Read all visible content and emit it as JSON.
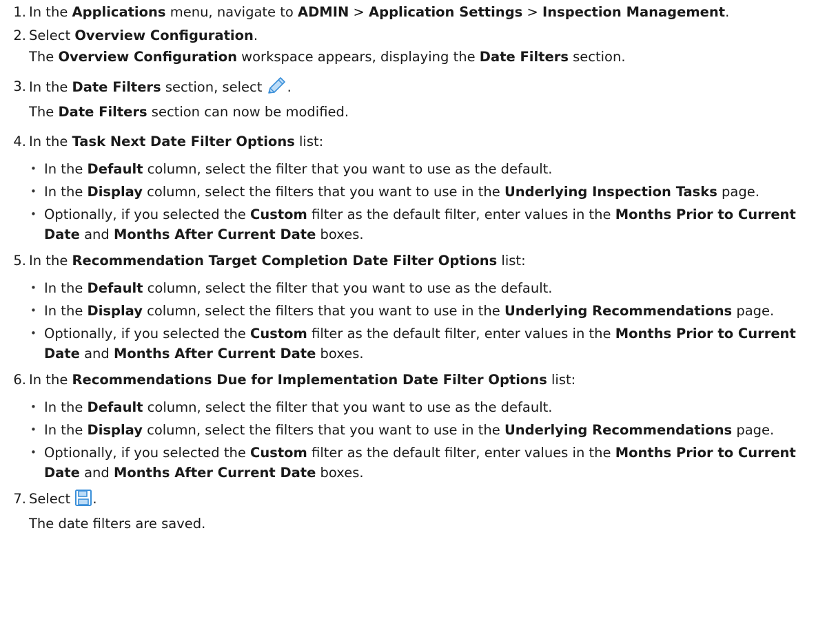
{
  "steps": [
    {
      "num": "1",
      "a": "In the ",
      "b": "Applications",
      "c": " menu, navigate to ",
      "d": "ADMIN",
      "e": " > ",
      "f": "Application Settings",
      "g": " > ",
      "h": "Inspection Management",
      "i": "."
    },
    {
      "num": "2",
      "a": "Select ",
      "b": "Overview Configuration",
      "c": ".",
      "result_a": "The ",
      "result_b": "Overview Configuration",
      "result_c": " workspace appears, displaying the ",
      "result_d": "Date Filters",
      "result_e": " section."
    },
    {
      "num": "3",
      "a": "In the ",
      "b": "Date Filters",
      "c": " section, select ",
      "icon": "pencil-icon",
      "d": ".",
      "result_a": "The ",
      "result_b": "Date Filters",
      "result_c": " section can now be modified."
    },
    {
      "num": "4",
      "a": "In the ",
      "b": "Task Next Date Filter Options",
      "c": " list:",
      "bullets": [
        {
          "a": "In the ",
          "b": "Default",
          "c": " column, select the filter that you want to use as the default."
        },
        {
          "a": "In the ",
          "b": "Display",
          "c": " column, select the filters that you want to use in the ",
          "d": "Underlying Inspection Tasks",
          "e": " page."
        },
        {
          "a": "Optionally, if you selected the ",
          "b": "Custom",
          "c": " filter as the default filter, enter values in the ",
          "d": "Months Prior to Current Date",
          "e": " and ",
          "f": "Months After Current Date",
          "g": " boxes."
        }
      ]
    },
    {
      "num": "5",
      "a": "In the ",
      "b": "Recommendation Target Completion Date Filter Options",
      "c": " list:",
      "bullets": [
        {
          "a": "In the ",
          "b": "Default",
          "c": " column, select the filter that you want to use as the default."
        },
        {
          "a": "In the ",
          "b": "Display",
          "c": " column, select the filters that you want to use in the ",
          "d": "Underlying Recommendations",
          "e": " page."
        },
        {
          "a": "Optionally, if you selected the ",
          "b": "Custom",
          "c": " filter as the default filter, enter values in the ",
          "d": "Months Prior to Current Date",
          "e": " and ",
          "f": "Months After Current Date",
          "g": " boxes."
        }
      ]
    },
    {
      "num": "6",
      "a": "In the ",
      "b": "Recommendations Due for Implementation Date Filter Options",
      "c": " list:",
      "bullets": [
        {
          "a": "In the ",
          "b": "Default",
          "c": " column, select the filter that you want to use as the default."
        },
        {
          "a": "In the ",
          "b": "Display",
          "c": " column, select the filters that you want to use in the ",
          "d": "Underlying Recommendations",
          "e": " page."
        },
        {
          "a": "Optionally, if you selected the ",
          "b": "Custom",
          "c": " filter as the default filter, enter values in the ",
          "d": "Months Prior to Current Date",
          "e": " and ",
          "f": "Months After Current Date",
          "g": " boxes."
        }
      ]
    },
    {
      "num": "7",
      "a": "Select ",
      "icon": "save-icon",
      "b": ".",
      "result": "The date filters are saved."
    }
  ],
  "colors": {
    "icon_blue": "#3a8fd9",
    "icon_light": "#bcdcf7"
  }
}
